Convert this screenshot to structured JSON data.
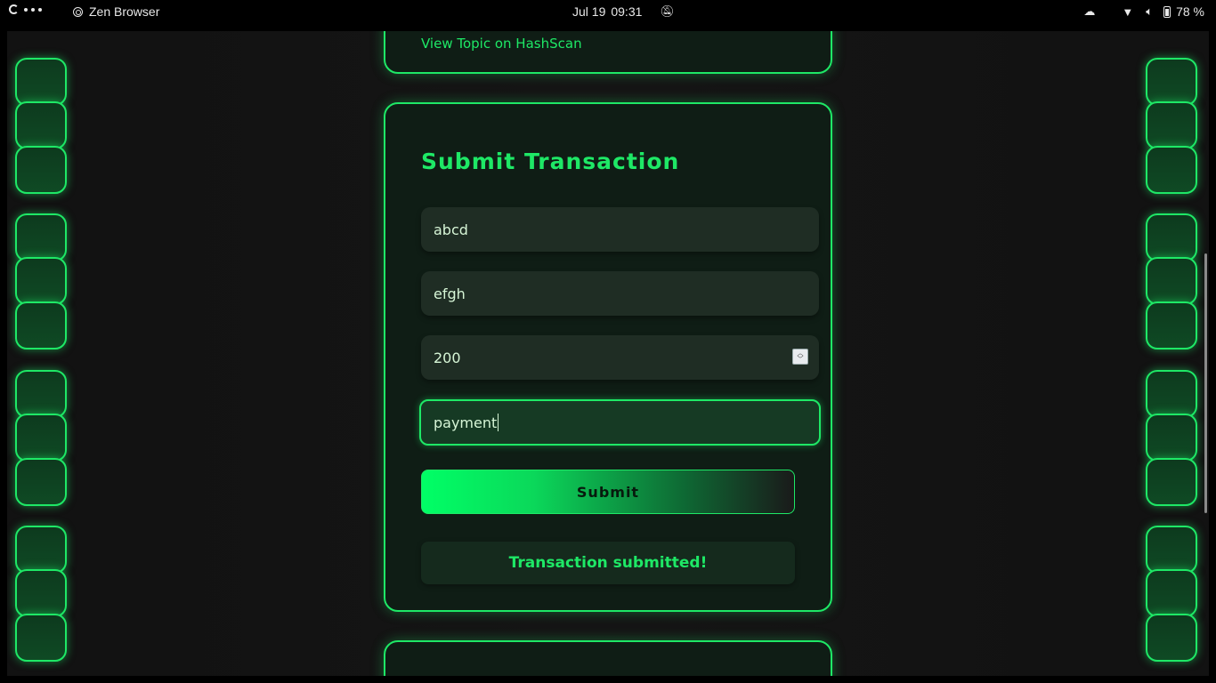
{
  "topbar": {
    "app_name": "Zen Browser",
    "date": "Jul 19",
    "time": "09:31",
    "battery_percent": "78 %",
    "icons": [
      "activities-icon",
      "app-icon",
      "bell-off-icon",
      "cloud-icon",
      "wifi-icon",
      "volume-icon",
      "battery-icon"
    ]
  },
  "prev_card": {
    "link_text": "View Topic on HashScan"
  },
  "form": {
    "title": "Submit Transaction",
    "fields": [
      {
        "value": "abcd"
      },
      {
        "value": "efgh"
      },
      {
        "value": "200"
      },
      {
        "value": "payment"
      }
    ],
    "submit_label": "Submit",
    "status_message": "Transaction submitted!"
  },
  "colors": {
    "accent": "#1ee866",
    "background": "#121212",
    "card": "#0f1d15",
    "field": "#1f2d24"
  }
}
